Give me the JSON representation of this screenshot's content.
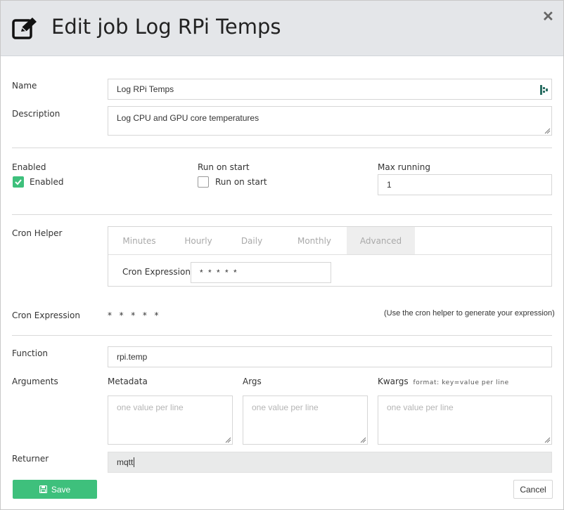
{
  "header": {
    "title": "Edit job Log RPi Temps",
    "close_glyph": "✕",
    "icon": "edit-icon"
  },
  "name": {
    "label": "Name",
    "value": "Log RPi Temps"
  },
  "description": {
    "label": "Description",
    "value": "Log CPU and GPU core temperatures"
  },
  "enabled": {
    "label": "Enabled",
    "checkbox_label": "Enabled",
    "checked": true
  },
  "run_on_start": {
    "label": "Run on start",
    "checkbox_label": "Run on start",
    "checked": false
  },
  "max_running": {
    "label": "Max running",
    "value": "1"
  },
  "cron_helper": {
    "label": "Cron Helper",
    "tabs": [
      "Minutes",
      "Hourly",
      "Daily",
      "Monthly",
      "Advanced"
    ],
    "active_tab": "Advanced",
    "expression_label": "Cron Expression",
    "expression_value": "* * * * *"
  },
  "cron_expression": {
    "label": "Cron Expression",
    "value": "*  *  *  *  *",
    "hint": "(Use the cron helper to generate your expression)"
  },
  "function": {
    "label": "Function",
    "value": "rpi.temp"
  },
  "arguments": {
    "label": "Arguments",
    "metadata": {
      "label": "Metadata",
      "placeholder": "one value per line"
    },
    "args": {
      "label": "Args",
      "placeholder": "one value per line"
    },
    "kwargs": {
      "label": "Kwargs",
      "format": "format: key=value per line",
      "placeholder": "one value per line"
    }
  },
  "returner": {
    "label": "Returner",
    "value": "mqtt"
  },
  "footer": {
    "save_label": "Save",
    "cancel_label": "Cancel"
  },
  "colors": {
    "accent": "#3ec07c",
    "header_bg": "#e4e6e9"
  }
}
